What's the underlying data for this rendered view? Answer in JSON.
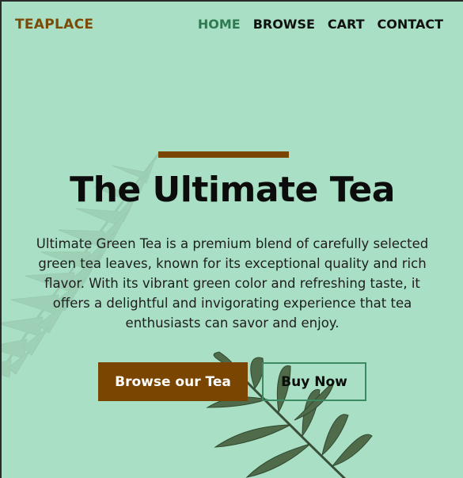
{
  "nav": {
    "brand": "TEAPLACE",
    "links": [
      {
        "label": "HOME",
        "active": true
      },
      {
        "label": "BROWSE",
        "active": false
      },
      {
        "label": "CART",
        "active": false
      },
      {
        "label": "CONTACT",
        "active": false
      }
    ]
  },
  "hero": {
    "title": "The Ultimate Tea",
    "description": "Ultimate Green Tea is a premium blend of carefully selected green tea leaves, known for its exceptional quality and rich flavor. With its vibrant green color and refreshing taste, it offers a delightful and invigorating experience that tea enthusiasts can savor and enjoy.",
    "primary_button": "Browse our Tea",
    "secondary_button": "Buy Now"
  },
  "colors": {
    "background": "#a9dfc4",
    "brand": "#7a4a06",
    "accent": "#7a4500",
    "active_nav": "#2f7a52"
  },
  "icons": {
    "fern": "fern-leaf-illustration",
    "palm": "palm-leaf-illustration"
  }
}
